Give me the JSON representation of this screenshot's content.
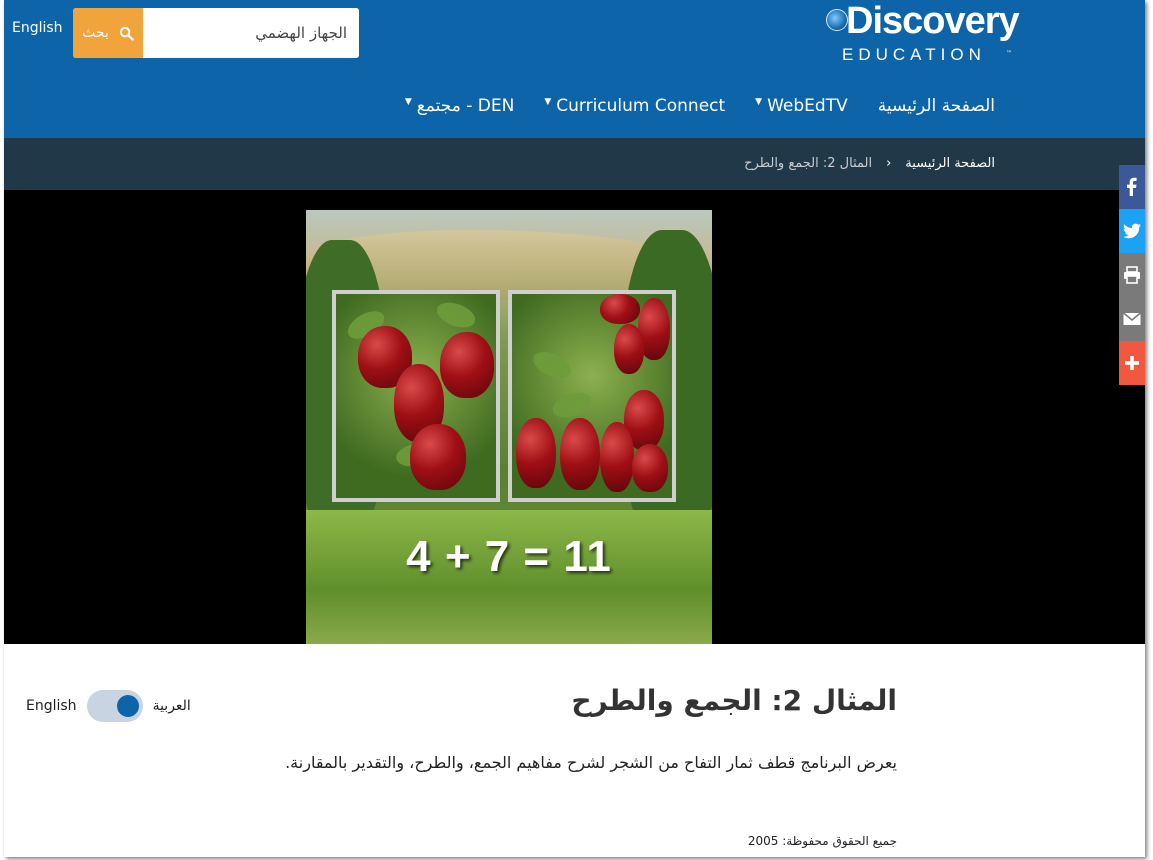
{
  "header": {
    "lang_link": "English",
    "search": {
      "button_label": "بحث",
      "value": "الجهاز الهضمي"
    },
    "logo": {
      "main": "Discovery",
      "sub": "EDUCATION",
      "tm": "™"
    },
    "nav": [
      {
        "label": "الصفحة الرئيسية",
        "dropdown": false
      },
      {
        "label": "WebEdTV",
        "dropdown": true
      },
      {
        "label": "Curriculum Connect",
        "dropdown": true
      },
      {
        "label": "مجتمع - DEN",
        "dropdown": true
      }
    ]
  },
  "breadcrumb": {
    "home": "الصفحة الرئيسية",
    "separator": "›",
    "current": "المثال 2: الجمع والطرح"
  },
  "video": {
    "equation": "4 + 7 = 11"
  },
  "share": [
    {
      "icon": "facebook-icon",
      "color": "#3b5998"
    },
    {
      "icon": "twitter-icon",
      "color": "#1da1f2"
    },
    {
      "icon": "print-icon",
      "color": "#7a7a7a"
    },
    {
      "icon": "email-icon",
      "color": "#7a7a7a"
    },
    {
      "icon": "plus-icon",
      "color": "#f2583f"
    }
  ],
  "content": {
    "title": "المثال 2: الجمع والطرح",
    "description": "يعرض البرنامج قطف ثمار التفاح من الشجر لشرح مفاهيم الجمع، والطرح، والتقدير بالمقارنة.",
    "copyright": "جميع الحقوق محفوظة: 2005",
    "lang_toggle": {
      "left_label": "English",
      "right_label": "العربية",
      "selected": "العربية"
    }
  },
  "colors": {
    "header": "#0e64a8",
    "search_button": "#f0a43b",
    "breadcrumb_bar": "#213849"
  }
}
